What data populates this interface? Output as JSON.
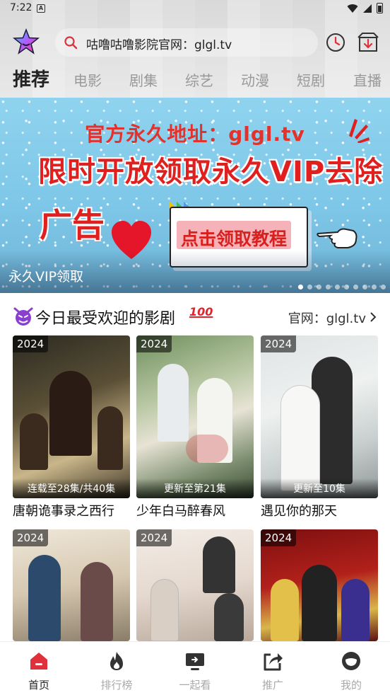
{
  "status_bar": {
    "time": "7:22",
    "notification_glyph": "A"
  },
  "header": {
    "search_text": "咕噜咕噜影院官网：glgl.tv",
    "icons": [
      "logo-star-icon",
      "search-icon",
      "history-icon",
      "download-icon"
    ]
  },
  "tabs": [
    {
      "label": "推荐",
      "active": true
    },
    {
      "label": "电影",
      "active": false
    },
    {
      "label": "剧集",
      "active": false
    },
    {
      "label": "综艺",
      "active": false
    },
    {
      "label": "动漫",
      "active": false
    },
    {
      "label": "短剧",
      "active": false
    },
    {
      "label": "直播",
      "active": false
    }
  ],
  "banner": {
    "line1": "官方永久地址：glgl.tv",
    "line2": "限时开放领取永久VIP去除",
    "line3": "广告",
    "button_text": "点击领取教程",
    "caption": "永久VIP领取",
    "slide_count": 10,
    "active_slide": 1
  },
  "section": {
    "title": "今日最受欢迎的影剧",
    "title_emoji_left": "devil-icon",
    "title_emoji_right": "100",
    "link": "官网：glgl.tv"
  },
  "cards": [
    {
      "year": "2024",
      "episodes": "连载至28集/共40集",
      "title": "唐朝诡事录之西行"
    },
    {
      "year": "2024",
      "episodes": "更新至第21集",
      "title": "少年白马醉春风"
    },
    {
      "year": "2024",
      "episodes": "更新至10集",
      "title": "遇见你的那天"
    },
    {
      "year": "2024",
      "episodes": "",
      "title": ""
    },
    {
      "year": "2024",
      "episodes": "",
      "title": ""
    },
    {
      "year": "2024",
      "episodes": "",
      "title": ""
    }
  ],
  "bottom_nav": [
    {
      "label": "首页",
      "icon": "home-icon",
      "active": true
    },
    {
      "label": "排行榜",
      "icon": "fire-icon",
      "active": false
    },
    {
      "label": "一起看",
      "icon": "tv-icon",
      "active": false
    },
    {
      "label": "推广",
      "icon": "share-icon",
      "active": false
    },
    {
      "label": "我的",
      "icon": "profile-icon",
      "active": false
    }
  ],
  "colors": {
    "accent": "#e0303b",
    "inactive": "#999999",
    "banner_red": "#e01f1f"
  }
}
